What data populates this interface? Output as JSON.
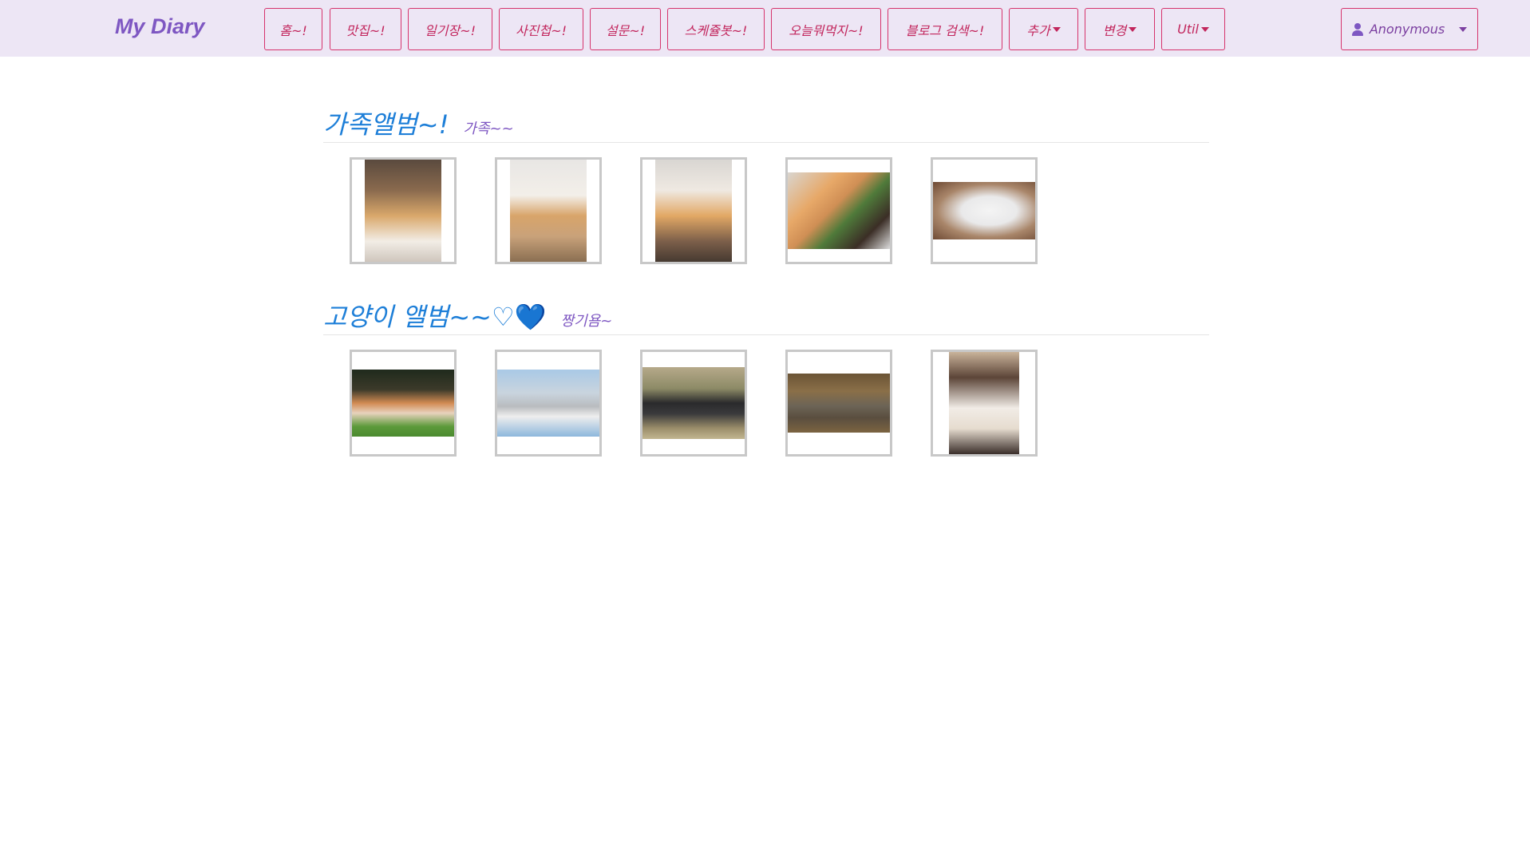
{
  "brand": "My Diary",
  "nav": [
    {
      "label": "홈~!"
    },
    {
      "label": "맛집~!"
    },
    {
      "label": "일기장~!"
    },
    {
      "label": "사진첩~!"
    },
    {
      "label": "설문~!"
    },
    {
      "label": "스케쥴봇~!"
    },
    {
      "label": "오늘뭐먹지~!"
    },
    {
      "label": "블로그 검색~!"
    },
    {
      "label": "추가"
    },
    {
      "label": "변경"
    },
    {
      "label": "Util"
    }
  ],
  "user": {
    "name": "Anonymous"
  },
  "albums": [
    {
      "title": "가족앨범~!",
      "subtitle": "가족~~",
      "photo_count": 5
    },
    {
      "title": "고양이 앨범~~♡",
      "title_heart": "💙",
      "subtitle": "짱기욤~",
      "photo_count": 5
    }
  ],
  "colors": {
    "navbar_bg": "#ede6f5",
    "brand": "#7e57c2",
    "nav_border": "#d6336c",
    "album_title": "#1e7fd8",
    "subtitle": "#7e57c2"
  }
}
